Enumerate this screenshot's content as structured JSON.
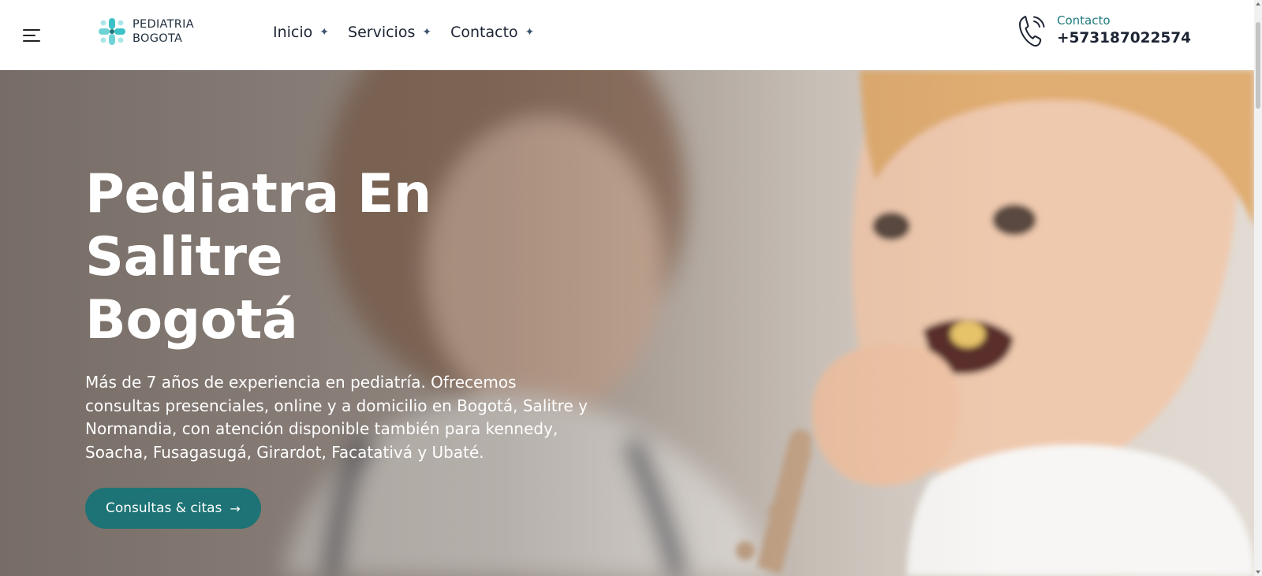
{
  "header": {
    "menu_icon": "hamburger-menu-icon",
    "logo": {
      "line1": "PEDIATRIA",
      "line2": "BOGOTA",
      "icon": "medical-cross-icon"
    },
    "nav": [
      {
        "label": "Inicio",
        "icon": "sparkle-icon"
      },
      {
        "label": "Servicios",
        "icon": "sparkle-icon"
      },
      {
        "label": "Contacto",
        "icon": "sparkle-icon"
      }
    ],
    "contact": {
      "label": "Contacto",
      "phone": "+573187022574",
      "icon": "phone-call-icon"
    }
  },
  "hero": {
    "title_line1": "Pediatra En Salitre",
    "title_line2": "Bogotá",
    "description": "Más de 7 años de experiencia en pediatría. Ofrecemos consultas presenciales, online y a domicilio en Bogotá, Salitre y Normandia, con atención disponible también para kennedy, Soacha, Fusagasugá, Girardot, Facatativá y Ubaté.",
    "cta_label": "Consultas & citas",
    "cta_icon": "arrow-right-icon"
  },
  "colors": {
    "accent": "#1d7375",
    "contact_label": "#1e7a7d",
    "text_dark": "#1d2433",
    "logo_cyan": "#3cc2c6"
  }
}
